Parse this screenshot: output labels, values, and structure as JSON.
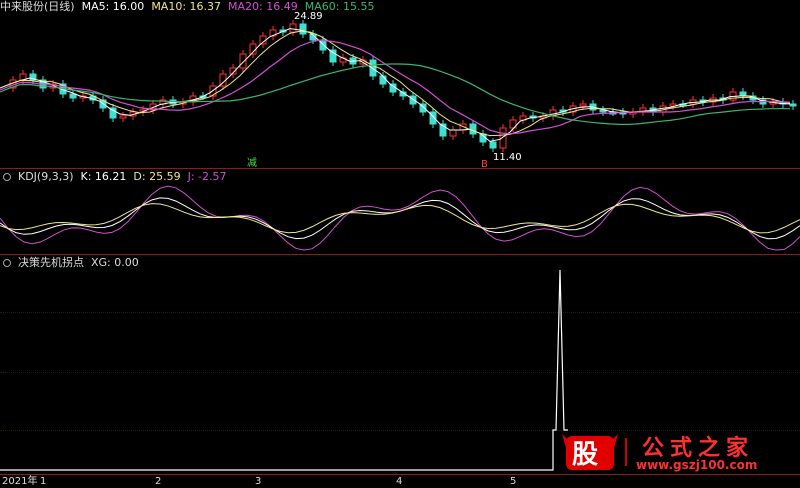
{
  "price_panel": {
    "title": "中来股份(日线)",
    "indicators": [
      {
        "label": "MA5: 16.00",
        "color": "#ffffff"
      },
      {
        "label": "MA10: 16.37",
        "color": "#f0e68c"
      },
      {
        "label": "MA20: 16.49",
        "color": "#d050d0"
      },
      {
        "label": "MA60: 15.55",
        "color": "#3cb371"
      }
    ],
    "high_label": "24.89",
    "low_label": "11.40",
    "marker_sell": "减",
    "marker_buy": "B"
  },
  "kdj_panel": {
    "title": "KDJ(9,3,3)",
    "k_label": "K: 16.21",
    "d_label": "D: 25.59",
    "j_label": "J: -2.57",
    "colors": {
      "k": "#ffffff",
      "d": "#f0e68c",
      "j": "#d050d0"
    }
  },
  "xg_panel": {
    "title": "决策先机拐点",
    "value_label": "XG: 0.00"
  },
  "time_axis": {
    "labels": [
      "2021年",
      "1",
      "2",
      "3",
      "4",
      "5"
    ]
  },
  "logo": {
    "badge": "股",
    "name": "公式之家",
    "url": "www.gszj100.com"
  },
  "colors": {
    "up": "#ff3030",
    "down": "#40e0d0",
    "separator": "#8b1a1a",
    "background": "#000000"
  }
}
